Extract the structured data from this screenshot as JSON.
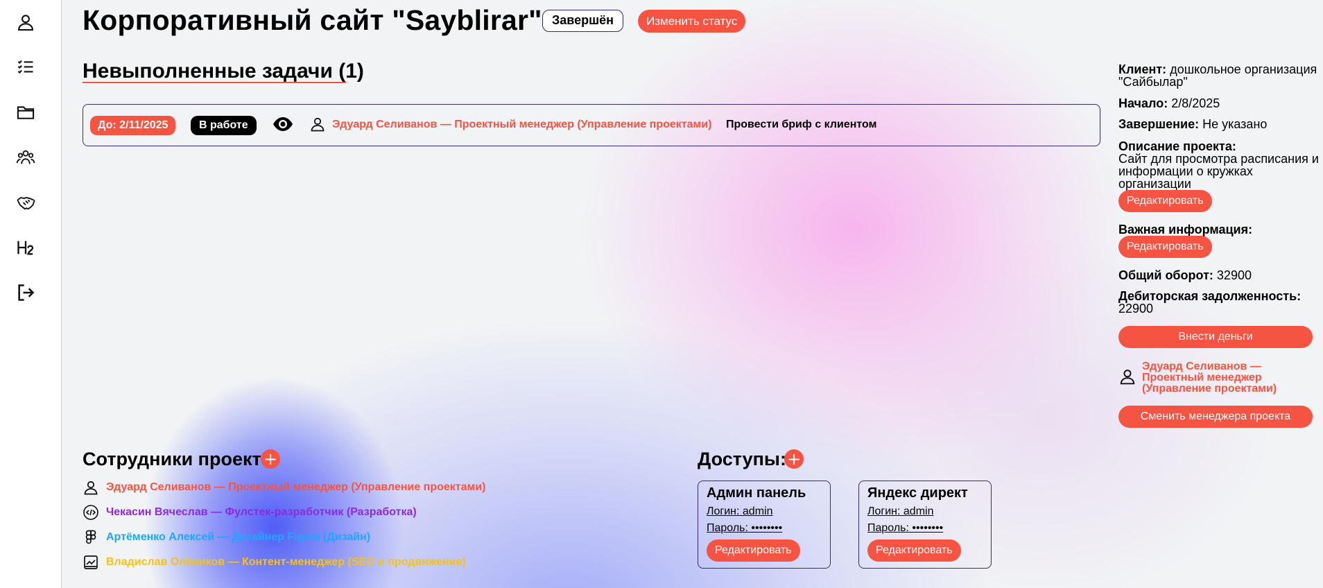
{
  "sidebar": {
    "items": [
      {
        "icon": "user-icon"
      },
      {
        "icon": "checklist-icon"
      },
      {
        "icon": "folder-icon"
      },
      {
        "icon": "team-icon"
      },
      {
        "icon": "handshake-icon"
      },
      {
        "icon": "heading-icon"
      },
      {
        "icon": "logout-icon"
      }
    ]
  },
  "header": {
    "title": "Корпоративный сайт \"Sayblirar\"",
    "status_badge": "Завершён",
    "change_status_label": "Изменить статус"
  },
  "tasks": {
    "heading": "Невыполненные задачи (1)",
    "items": [
      {
        "due": "До: 2/11/2025",
        "status": "В работе",
        "assignee": "Эдуард Селиванов — Проектный менеджер (Управление проектами)",
        "title": "Провести бриф с клиентом"
      }
    ]
  },
  "info": {
    "client_label": "Клиент:",
    "client_value": "дошкольное организация \"Сайбылар\"",
    "start_label": "Начало:",
    "start_value": "2/8/2025",
    "end_label": "Завершение:",
    "end_value": "Не указано",
    "description_label": "Описание проекта:",
    "description_value": "Сайт для просмотра расписания и информации о кружках организации",
    "edit_label": "Редактировать",
    "important_label": "Важная информация:",
    "turnover_label": "Общий оборот:",
    "turnover_value": "32900",
    "debt_label": "Дебиторская задолженность:",
    "debt_value": "22900",
    "deposit_label": "Внести деньги",
    "manager": "Эдуард Селиванов — Проектный менеджер (Управление проектами)",
    "change_manager_label": "Сменить менеджера проекта"
  },
  "staff": {
    "heading": "Сотрудники проекта",
    "add_label": "+",
    "members": [
      {
        "icon": "user-icon",
        "text": "Эдуард Селиванов — Проектный менеджер (Управление проектами)",
        "color": "#f55443"
      },
      {
        "icon": "code-icon",
        "text": "Чекасин Вячеслав — Фулстек-разработчик (Разработка)",
        "color": "#8a2be2"
      },
      {
        "icon": "figma-icon",
        "text": "Артёменко Алексей — Дизайнер Figma (Дизайн)",
        "color": "#1ea7ff"
      },
      {
        "icon": "chart-icon",
        "text": "Владислав Олёников — Контент-менеджер (SEO и продвижение)",
        "color": "#f3c21b"
      }
    ]
  },
  "access": {
    "heading": "Доступы:",
    "add_label": "+",
    "cards": [
      {
        "title": "Админ панель",
        "login": "Логин: admin",
        "password": "Пароль: ••••••••",
        "edit_label": "Редактировать"
      },
      {
        "title": "Яндекс директ",
        "login": "Логин: admin",
        "password": "Пароль: ••••••••",
        "edit_label": "Редактировать"
      }
    ]
  },
  "colors": {
    "accent": "#f55443",
    "border": "#3a2a7a"
  }
}
